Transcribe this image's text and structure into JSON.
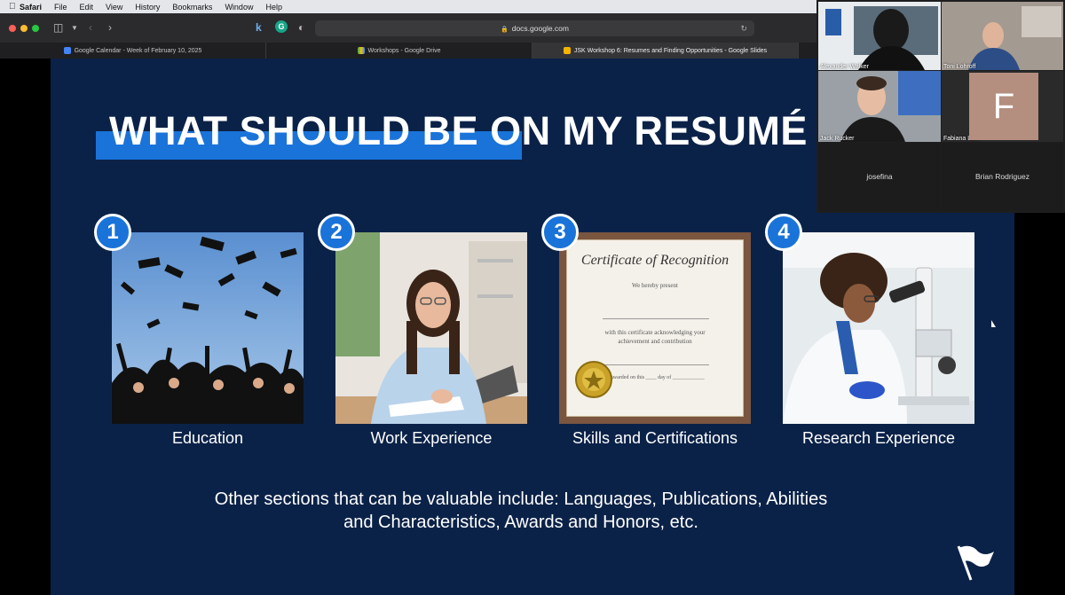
{
  "menubar": {
    "items": [
      "Safari",
      "File",
      "Edit",
      "View",
      "History",
      "Bookmarks",
      "Window",
      "Help"
    ]
  },
  "toolbar": {
    "url": "docs.google.com"
  },
  "tabs": [
    {
      "label": "Google Calendar - Week of February 10, 2025",
      "color": "#4285f4"
    },
    {
      "label": "Workshops - Google Drive",
      "color": "#fbbc04"
    },
    {
      "label": "JSK Workshop 6: Resumes and Finding Opportunities - Google Slides",
      "color": "#f4b400"
    }
  ],
  "slide": {
    "title": "WHAT SHOULD BE ON MY RESUMÉ O",
    "cards": [
      {
        "number": "1",
        "caption": "Education",
        "icon": "graduation-photo"
      },
      {
        "number": "2",
        "caption": "Work Experience",
        "icon": "working-woman-photo"
      },
      {
        "number": "3",
        "caption": "Skills and Certifications",
        "icon": "certificate-photo"
      },
      {
        "number": "4",
        "caption": "Research Experience",
        "icon": "scientist-microscope-photo"
      }
    ],
    "certificate": {
      "heading": "Certificate of Recognition",
      "line1": "We hereby present",
      "line2": "with this certificate acknowledging your",
      "line3": "achievement and contribution",
      "line4": "Awarded on this ____ day of ____________"
    },
    "other_line1": "Other sections that can be valuable include: Languages, Publications, Abilities",
    "other_line2": "and Characteristics, Awards and Honors, etc.",
    "colors": {
      "background": "#0b2248",
      "accent": "#1a73d9"
    }
  },
  "video": {
    "participants": [
      {
        "name": "Alexander Walker"
      },
      {
        "name": "Toni Lohroff"
      },
      {
        "name": "Jack Rucker"
      },
      {
        "name": "Fabiana Lara",
        "initial": "F"
      },
      {
        "name": "josefina"
      },
      {
        "name": "Brian Rodriguez"
      }
    ]
  }
}
